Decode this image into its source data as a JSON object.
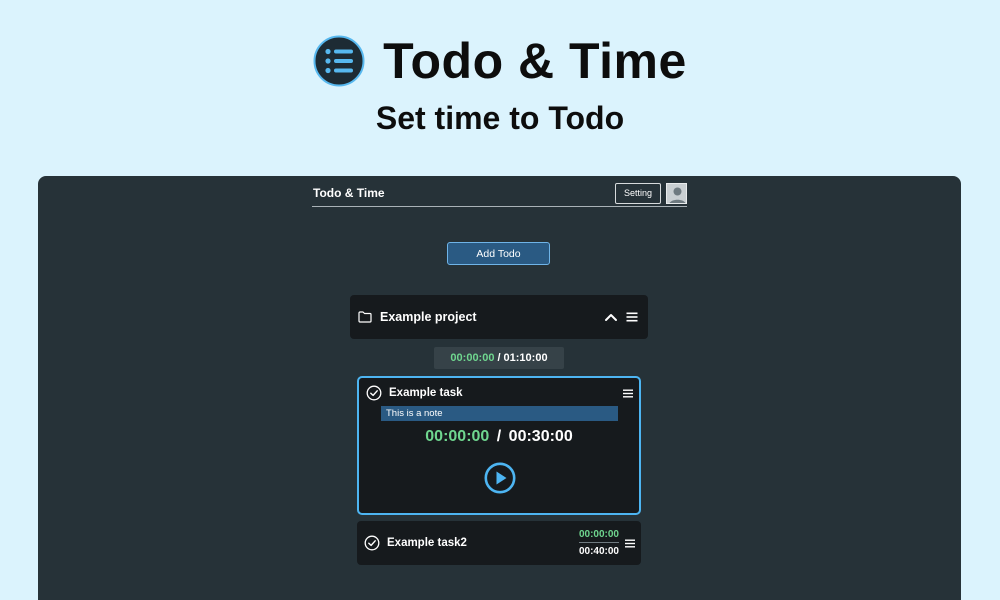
{
  "hero": {
    "title": "Todo & Time",
    "subtitle": "Set time to Todo",
    "logo_icon": "list-icon"
  },
  "app": {
    "title": "Todo & Time",
    "setting_label": "Setting",
    "add_todo_label": "Add Todo"
  },
  "project": {
    "name": "Example project",
    "elapsed": "00:00:00",
    "separator": "/",
    "total": "01:10:00"
  },
  "tasks": [
    {
      "name": "Example task",
      "note": "This is a note",
      "elapsed": "00:00:00",
      "separator": "/",
      "total": "00:30:00"
    },
    {
      "name": "Example task2",
      "elapsed": "00:00:00",
      "total": "00:40:00"
    }
  ],
  "colors": {
    "background": "#dbf3fd",
    "window": "#263238",
    "card": "#161a1d",
    "accent": "#4db5f2",
    "button": "#2a5a83",
    "elapsed": "#6fd68f"
  }
}
